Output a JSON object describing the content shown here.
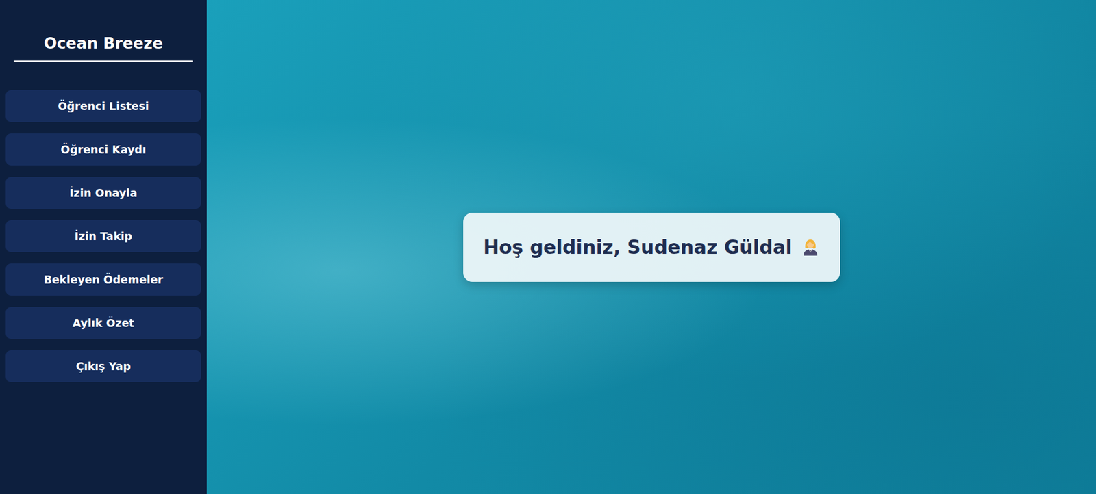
{
  "sidebar": {
    "title": "Ocean Breeze",
    "items": [
      {
        "label": "Öğrenci Listesi"
      },
      {
        "label": "Öğrenci Kaydı"
      },
      {
        "label": "İzin Onayla"
      },
      {
        "label": "İzin Takip"
      },
      {
        "label": "Bekleyen Ödemeler"
      },
      {
        "label": "Aylık Özet"
      },
      {
        "label": "Çıkış Yap"
      }
    ]
  },
  "welcome": {
    "text": "Hoş geldiniz, Sudenaz Güldal"
  }
}
